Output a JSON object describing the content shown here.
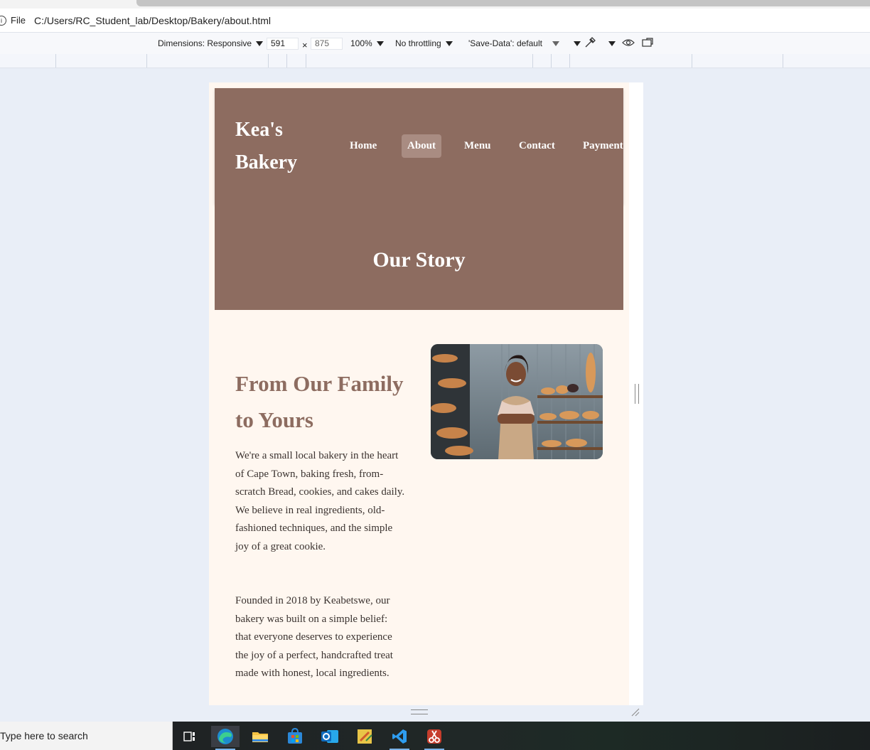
{
  "browser": {
    "file_label": "File",
    "url": "C:/Users/RC_Student_lab/Desktop/Bakery/about.html"
  },
  "devtools": {
    "dimensions_label": "Dimensions: Responsive",
    "width": "591",
    "height": "875",
    "zoom": "100%",
    "throttling": "No throttling",
    "save_data": "'Save-Data': default"
  },
  "site": {
    "logo": "Kea's Bakery",
    "nav": [
      {
        "label": "Home",
        "active": false
      },
      {
        "label": "About",
        "active": true
      },
      {
        "label": "Menu",
        "active": false
      },
      {
        "label": "Contact",
        "active": false
      },
      {
        "label": "Payment",
        "active": false
      }
    ],
    "hero_title": "Our Story",
    "heading": "From Our Family to Yours",
    "paragraph1": "We're a small local bakery in the heart of Cape Town, baking fresh, from-scratch Bread, cookies, and cakes daily. We believe in real ingredients, old-fashioned techniques, and the simple joy of a great cookie.",
    "paragraph2": "Founded in 2018 by Keabetswe, our bakery was built on a simple belief: that everyone deserves to experience the joy of a perfect, handcrafted treat made with honest, local ingredients."
  },
  "taskbar": {
    "search_placeholder": "Type here to search",
    "icons": [
      "task-view-icon",
      "edge-icon",
      "file-explorer-icon",
      "store-icon",
      "outlook-icon",
      "sticky-notes-icon",
      "vscode-icon",
      "snipping-tool-icon"
    ]
  },
  "colors": {
    "brand_brown": "#8d6c60",
    "page_bg": "#fff7f0",
    "active_nav": "#a98c82"
  }
}
